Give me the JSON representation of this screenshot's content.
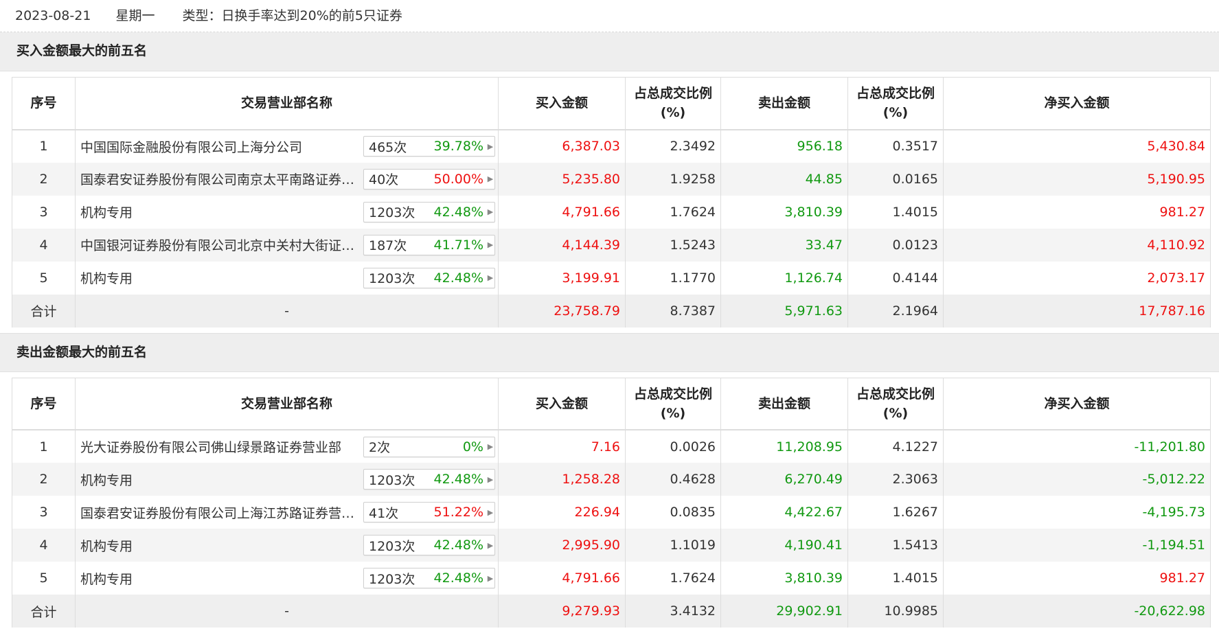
{
  "header": {
    "date": "2023-08-21",
    "weekday": "星期一",
    "type": "类型：日换手率达到20%的前5只证券"
  },
  "columns": {
    "idx": "序号",
    "name": "交易营业部名称",
    "buy": "买入金额",
    "buy_ratio": "占总成交比例(%)",
    "sell": "卖出金额",
    "sell_ratio": "占总成交比例(%)",
    "net": "净买入金额"
  },
  "colors": {
    "positive": "#ee1111",
    "negative": "#119911"
  },
  "icons": {
    "badge_arrow": "triangle-right-icon"
  },
  "buy_table": {
    "title": "买入金额最大的前五名",
    "rows": [
      {
        "idx": "1",
        "name": "中国国际金融股份有限公司上海分公司",
        "count": "465次",
        "pct": "39.78%",
        "pct_color": "green",
        "buy": "6,387.03",
        "buy_ratio": "2.3492",
        "sell": "956.18",
        "sell_ratio": "0.3517",
        "net": "5,430.84",
        "net_color": "red"
      },
      {
        "idx": "2",
        "name": "国泰君安证券股份有限公司南京太平南路证券营业部",
        "count": "40次",
        "pct": "50.00%",
        "pct_color": "red",
        "buy": "5,235.80",
        "buy_ratio": "1.9258",
        "sell": "44.85",
        "sell_ratio": "0.0165",
        "net": "5,190.95",
        "net_color": "red"
      },
      {
        "idx": "3",
        "name": "机构专用",
        "count": "1203次",
        "pct": "42.48%",
        "pct_color": "green",
        "buy": "4,791.66",
        "buy_ratio": "1.7624",
        "sell": "3,810.39",
        "sell_ratio": "1.4015",
        "net": "981.27",
        "net_color": "red"
      },
      {
        "idx": "4",
        "name": "中国银河证券股份有限公司北京中关村大街证券营业部",
        "count": "187次",
        "pct": "41.71%",
        "pct_color": "green",
        "buy": "4,144.39",
        "buy_ratio": "1.5243",
        "sell": "33.47",
        "sell_ratio": "0.0123",
        "net": "4,110.92",
        "net_color": "red"
      },
      {
        "idx": "5",
        "name": "机构专用",
        "count": "1203次",
        "pct": "42.48%",
        "pct_color": "green",
        "buy": "3,199.91",
        "buy_ratio": "1.1770",
        "sell": "1,126.74",
        "sell_ratio": "0.4144",
        "net": "2,073.17",
        "net_color": "red"
      }
    ],
    "total": {
      "label": "合计",
      "name": "-",
      "buy": "23,758.79",
      "buy_ratio": "8.7387",
      "sell": "5,971.63",
      "sell_ratio": "2.1964",
      "net": "17,787.16",
      "net_color": "red"
    }
  },
  "sell_table": {
    "title": "卖出金额最大的前五名",
    "rows": [
      {
        "idx": "1",
        "name": "光大证券股份有限公司佛山绿景路证券营业部",
        "count": "2次",
        "pct": "0%",
        "pct_color": "green",
        "buy": "7.16",
        "buy_ratio": "0.0026",
        "sell": "11,208.95",
        "sell_ratio": "4.1227",
        "net": "-11,201.80",
        "net_color": "green"
      },
      {
        "idx": "2",
        "name": "机构专用",
        "count": "1203次",
        "pct": "42.48%",
        "pct_color": "green",
        "buy": "1,258.28",
        "buy_ratio": "0.4628",
        "sell": "6,270.49",
        "sell_ratio": "2.3063",
        "net": "-5,012.22",
        "net_color": "green"
      },
      {
        "idx": "3",
        "name": "国泰君安证券股份有限公司上海江苏路证券营业部",
        "count": "41次",
        "pct": "51.22%",
        "pct_color": "red",
        "buy": "226.94",
        "buy_ratio": "0.0835",
        "sell": "4,422.67",
        "sell_ratio": "1.6267",
        "net": "-4,195.73",
        "net_color": "green"
      },
      {
        "idx": "4",
        "name": "机构专用",
        "count": "1203次",
        "pct": "42.48%",
        "pct_color": "green",
        "buy": "2,995.90",
        "buy_ratio": "1.1019",
        "sell": "4,190.41",
        "sell_ratio": "1.5413",
        "net": "-1,194.51",
        "net_color": "green"
      },
      {
        "idx": "5",
        "name": "机构专用",
        "count": "1203次",
        "pct": "42.48%",
        "pct_color": "green",
        "buy": "4,791.66",
        "buy_ratio": "1.7624",
        "sell": "3,810.39",
        "sell_ratio": "1.4015",
        "net": "981.27",
        "net_color": "red"
      }
    ],
    "total": {
      "label": "合计",
      "name": "-",
      "buy": "9,279.93",
      "buy_ratio": "3.4132",
      "sell": "29,902.91",
      "sell_ratio": "10.9985",
      "net": "-20,622.98",
      "net_color": "green"
    }
  }
}
